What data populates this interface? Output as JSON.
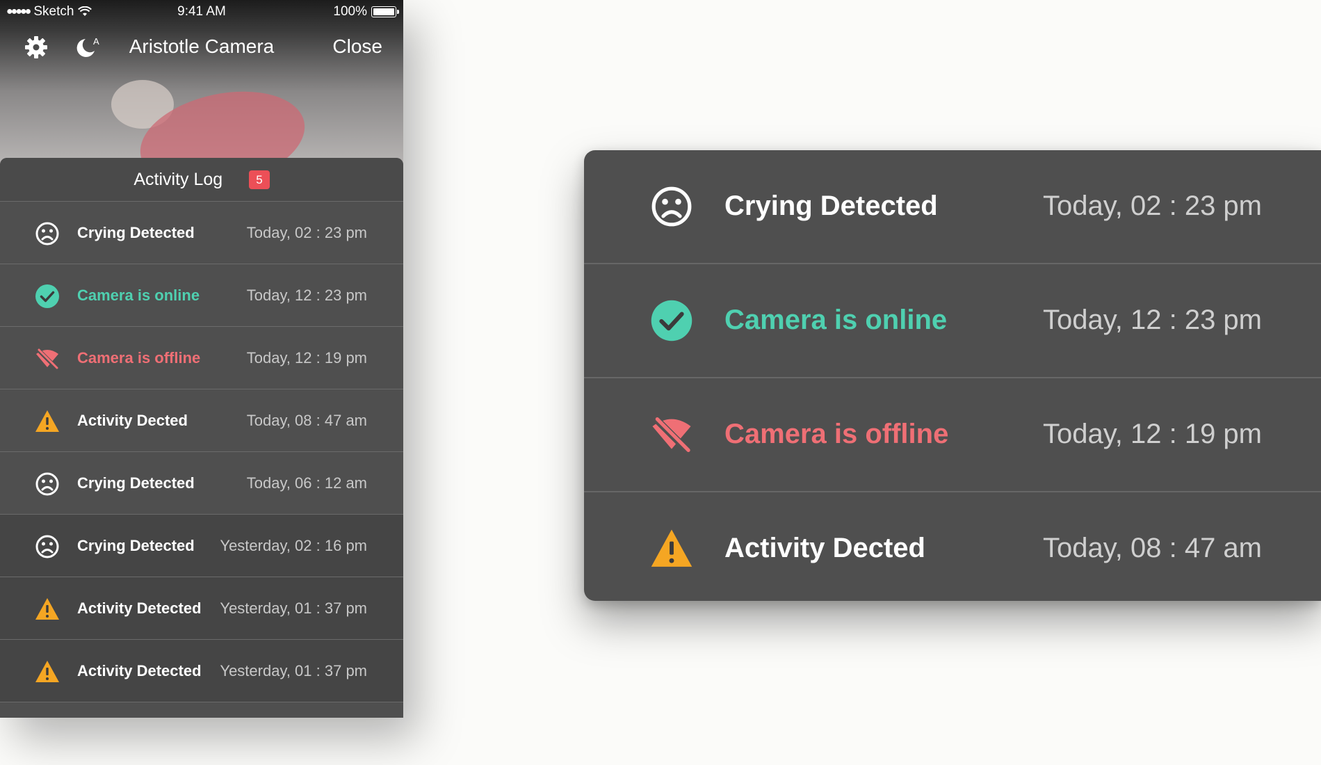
{
  "status_bar": {
    "signal": "●●●●●",
    "carrier": "Sketch",
    "time": "9:41 AM",
    "battery": "100%"
  },
  "nav": {
    "title": "Aristotle Camera",
    "close_label": "Close",
    "moon_badge": "A"
  },
  "activity_log": {
    "title": "Activity Log",
    "count": "5",
    "items": [
      {
        "label": "Crying Detected",
        "time": "Today, 02 : 23 pm",
        "icon": "sad-face-icon"
      },
      {
        "label": "Camera is online",
        "time": "Today, 12 : 23 pm",
        "icon": "check-circle-icon"
      },
      {
        "label": "Camera is offline",
        "time": "Today, 12 : 19 pm",
        "icon": "wifi-off-icon"
      },
      {
        "label": "Activity Dected",
        "time": "Today, 08 : 47 am",
        "icon": "warning-icon"
      },
      {
        "label": "Crying Detected",
        "time": "Today, 06 : 12 am",
        "icon": "sad-face-icon"
      },
      {
        "label": "Crying Detected",
        "time": "Yesterday, 02 : 16 pm",
        "icon": "sad-face-icon"
      },
      {
        "label": "Activity Detected",
        "time": "Yesterday, 01 : 37 pm",
        "icon": "warning-icon"
      },
      {
        "label": "Activity Detected",
        "time": "Yesterday, 01 : 37 pm",
        "icon": "warning-icon"
      }
    ]
  },
  "zoom_card": {
    "items": [
      {
        "label": "Crying Detected",
        "time": "Today, 02 : 23 pm",
        "icon": "sad-face-icon"
      },
      {
        "label": "Camera is online",
        "time": "Today, 12 : 23 pm",
        "icon": "check-circle-icon"
      },
      {
        "label": "Camera is offline",
        "time": "Today, 12 : 19 pm",
        "icon": "wifi-off-icon"
      },
      {
        "label": "Activity Dected",
        "time": "Today, 08 : 47 am",
        "icon": "warning-icon"
      }
    ]
  },
  "colors": {
    "online": "#4fd0b0",
    "offline": "#ef6f75",
    "warning": "#f5a623",
    "badge": "#ec4f57",
    "panel": "#4f4f4f"
  }
}
